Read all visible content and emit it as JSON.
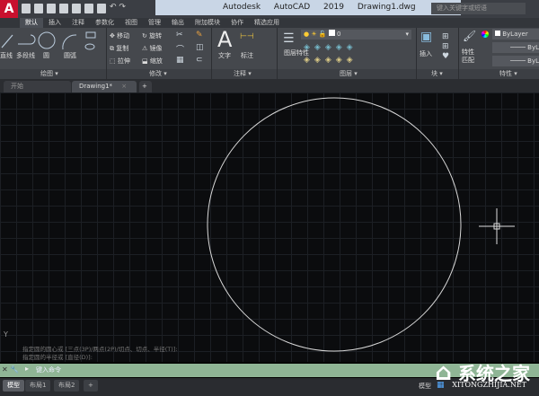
{
  "title": {
    "app": "Autodesk AutoCAD 2019",
    "file": "Drawing1.dwg",
    "search_placeholder": "键入关键字或短语",
    "logo": "A"
  },
  "ribbon_tabs": [
    "默认",
    "插入",
    "注释",
    "参数化",
    "视图",
    "管理",
    "输出",
    "附加模块",
    "协作",
    "精选应用"
  ],
  "draw_panel": {
    "label": "绘图",
    "tools": [
      "直线",
      "多段线",
      "圆",
      "圆弧"
    ]
  },
  "modify_panel": {
    "label": "修改",
    "tools": [
      "移动",
      "旋转",
      "复制",
      "镜像",
      "拉伸",
      "缩放"
    ]
  },
  "annotation_panel": {
    "label": "注释",
    "tools": [
      "文字",
      "标注"
    ]
  },
  "layers_panel": {
    "label": "图层",
    "tools": [
      "图层特性"
    ],
    "current_layer": "0"
  },
  "block_panel": {
    "label": "块",
    "tools": [
      "插入"
    ]
  },
  "properties_panel": {
    "label": "特性",
    "tools": [
      "特性匹配"
    ],
    "color": "ByLayer",
    "linetype": "ByL",
    "lineweight": "ByL"
  },
  "doc_tabs": [
    "开始",
    "Drawing1*"
  ],
  "command": {
    "history": [
      "指定圆的圆心或 [三点(3P)/两点(2P)/切点、切点、半径(T)]:",
      "指定圆的半径或 [直径(D)]:"
    ],
    "placeholder": "键入命令"
  },
  "layout_tabs": [
    "模型",
    "布局1",
    "布局2"
  ],
  "status": {
    "model": "模型"
  },
  "axis_label": "Y",
  "watermark": {
    "text": "系统之家",
    "url": "XITONGZHIJIA.NET"
  },
  "colors": {
    "cmd_bg": "#8fb595",
    "canvas": "#0b0c0e",
    "accent": "#c8102e"
  }
}
